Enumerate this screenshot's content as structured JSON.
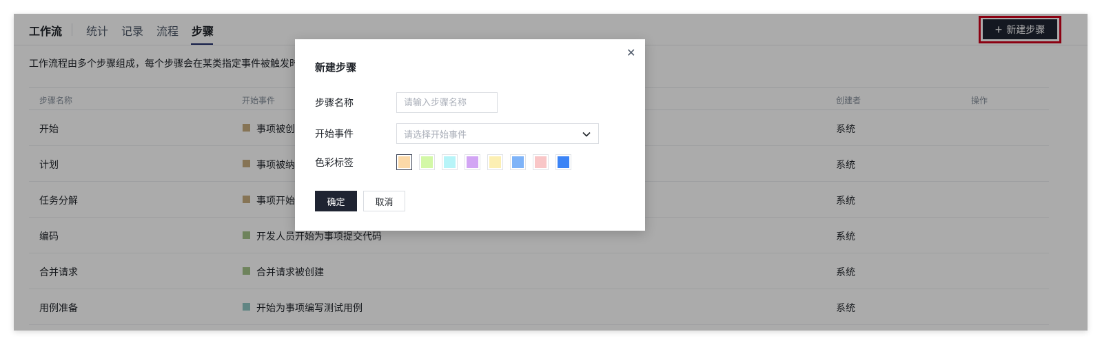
{
  "header": {
    "brand": "工作流",
    "tabs": [
      {
        "label": "统计"
      },
      {
        "label": "记录"
      },
      {
        "label": "流程"
      },
      {
        "label": "步骤"
      }
    ],
    "active_tab": "步骤",
    "new_button_label": "新建步骤"
  },
  "main": {
    "description": "工作流程由多个步骤组成，每个步骤会在某类指定事件被触发时",
    "table": {
      "columns": [
        "步骤名称",
        "开始事件",
        "创建者",
        "操作"
      ],
      "rows": [
        {
          "name": "开始",
          "event": "事项被创",
          "color": "#c8ad7f",
          "creator": "系统"
        },
        {
          "name": "计划",
          "event": "事项被纳",
          "color": "#c8ad7f",
          "creator": "系统"
        },
        {
          "name": "任务分解",
          "event": "事项开始",
          "color": "#c8ad7f",
          "creator": "系统"
        },
        {
          "name": "编码",
          "event": "开发人员开始为事项提交代码",
          "color": "#a4c48a",
          "creator": "系统"
        },
        {
          "name": "合并请求",
          "event": "合并请求被创建",
          "color": "#a4c48a",
          "creator": "系统"
        },
        {
          "name": "用例准备",
          "event": "开始为事项编写测试用例",
          "color": "#8fc6c4",
          "creator": "系统"
        }
      ]
    }
  },
  "dialog": {
    "title": "新建步骤",
    "fields": {
      "name_label": "步骤名称",
      "name_placeholder": "请输入步骤名称",
      "name_value": "",
      "event_label": "开始事件",
      "event_placeholder": "请选择开始事件",
      "color_label": "色彩标签"
    },
    "colors": [
      "#fcd9a8",
      "#d3f8a7",
      "#b7f4f8",
      "#d2a5f4",
      "#fcefb3",
      "#7eb3f8",
      "#f9c6c7",
      "#3c84f6"
    ],
    "selected_color_index": 0,
    "ok_label": "确定",
    "cancel_label": "取消"
  },
  "colors": {
    "primary_dark": "#1f2432",
    "highlight_border": "#d0021b",
    "tab_underline": "#1d2b6b"
  }
}
